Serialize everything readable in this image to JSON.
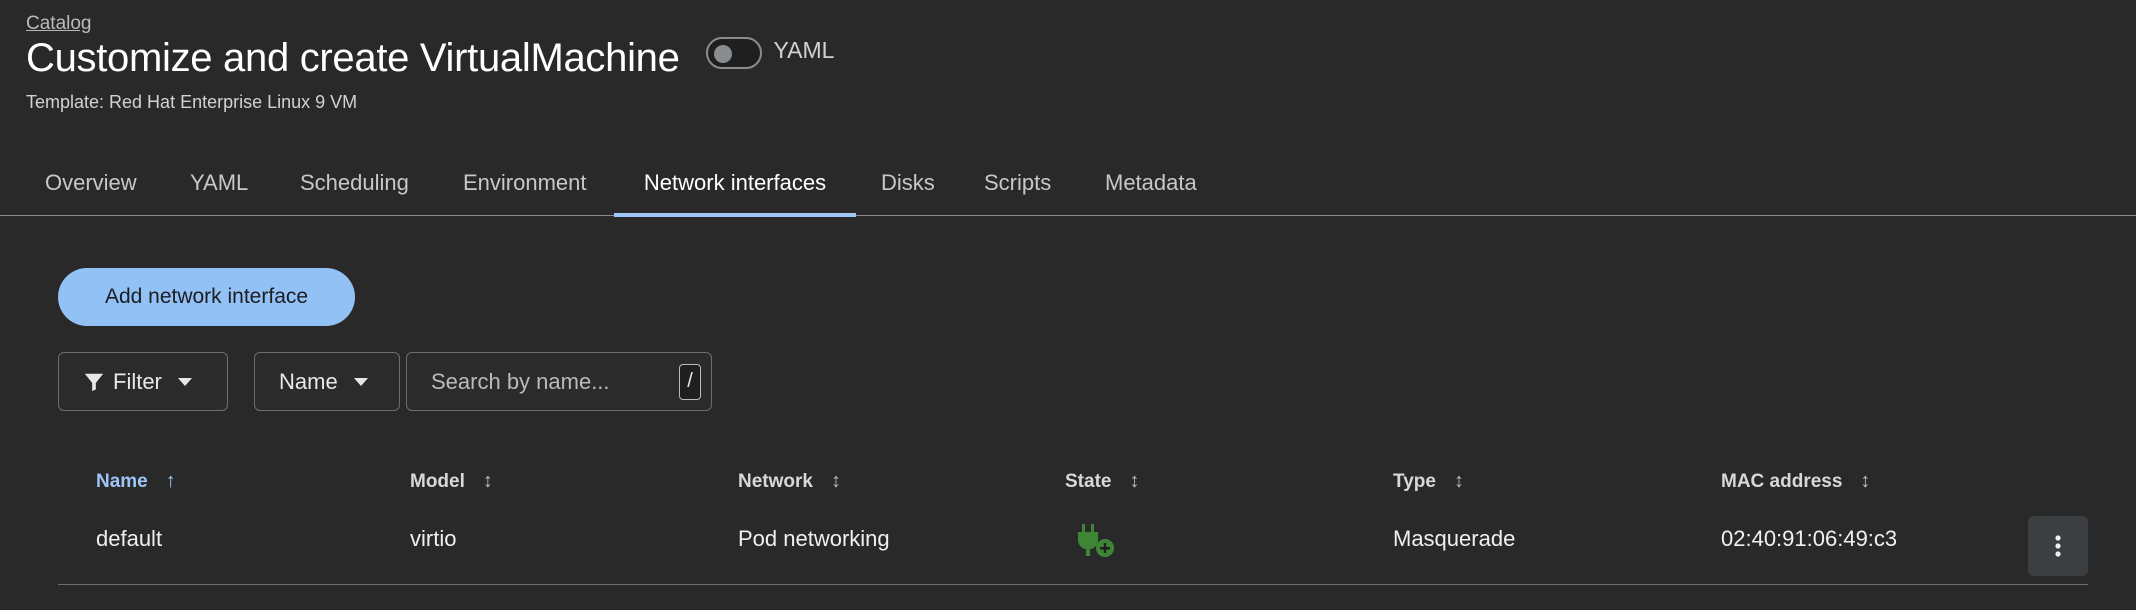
{
  "header": {
    "breadcrumb": "Catalog",
    "title": "Customize and create VirtualMachine",
    "yaml_toggle_label": "YAML",
    "subtitle": "Template: Red Hat Enterprise Linux 9 VM"
  },
  "tabs": [
    {
      "label": "Overview"
    },
    {
      "label": "YAML"
    },
    {
      "label": "Scheduling"
    },
    {
      "label": "Environment"
    },
    {
      "label": "Network interfaces",
      "active": true
    },
    {
      "label": "Disks"
    },
    {
      "label": "Scripts"
    },
    {
      "label": "Metadata"
    }
  ],
  "actions": {
    "add_network_interface": "Add network interface"
  },
  "toolbar": {
    "filter_label": "Filter",
    "name_label": "Name",
    "search_placeholder": "Search by name...",
    "search_shortcut": "/"
  },
  "table": {
    "columns": [
      "Name",
      "Model",
      "Network",
      "State",
      "Type",
      "MAC address"
    ],
    "rows": [
      {
        "name": "default",
        "model": "virtio",
        "network": "Pod networking",
        "state_icon": "plug-add-icon",
        "type": "Masquerade",
        "mac": "02:40:91:06:49:c3"
      }
    ]
  },
  "colors": {
    "background": "#292929",
    "accent": "#9ec5f5",
    "primary_button": "#92c1f6",
    "state_green": "#3e8635"
  }
}
